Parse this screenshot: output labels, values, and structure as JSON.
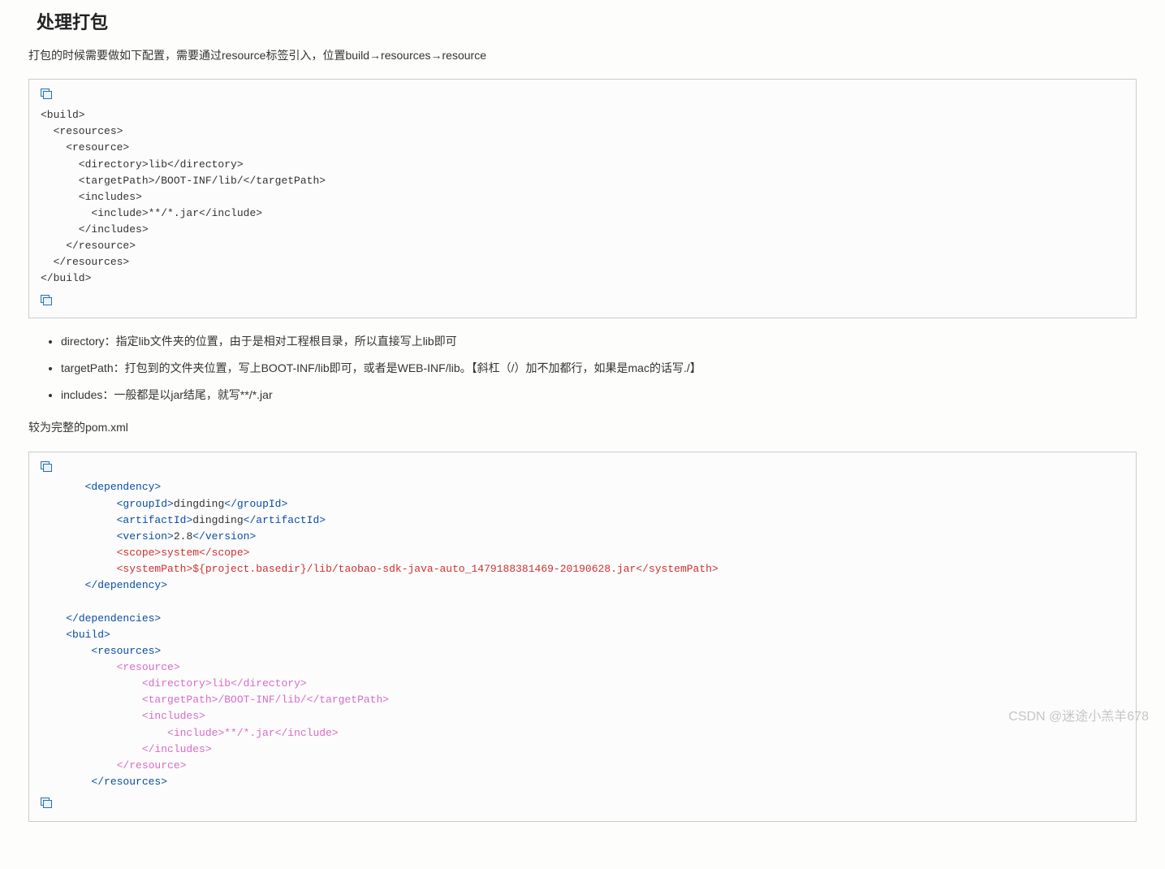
{
  "heading": "处理打包",
  "intro": "打包的时候需要做如下配置，需要通过resource标签引入，位置build→resources→resource",
  "code1": "<build>\n  <resources>\n    <resource>\n      <directory>lib</directory>\n      <targetPath>/BOOT-INF/lib/</targetPath>\n      <includes>\n        <include>**/*.jar</include>\n      </includes>\n    </resource>\n  </resources>\n</build>",
  "bullets": [
    "directory：指定lib文件夹的位置，由于是相对工程根目录，所以直接写上lib即可",
    "targetPath：打包到的文件夹位置，写上BOOT-INF/lib即可，或者是WEB-INF/lib。【斜杠（/）加不加都行，如果是mac的话写./】",
    "includes：一般都是以jar结尾，就写**/*.jar"
  ],
  "pomline": "较为完整的pom.xml",
  "code2": {
    "dep_open": "<dependency>",
    "group": {
      "o": "<groupId>",
      "t": "dingding",
      "c": "</groupId>"
    },
    "artifact": {
      "o": "<artifactId>",
      "t": "dingding",
      "c": "</artifactId>"
    },
    "version": {
      "o": "<version>",
      "t": "2.8",
      "c": "</version>"
    },
    "scope": {
      "o": "<scope>",
      "t": "system",
      "c": "</scope>"
    },
    "syspath": {
      "o": "<systemPath>",
      "t": "${project.basedir}/lib/taobao-sdk-java-auto_1479188381469-20190628.jar",
      "c": "</systemPath>"
    },
    "dep_close": "</dependency>",
    "deps_close": "</dependencies>",
    "build_open": "<build>",
    "resources_open": "<resources>",
    "resource_open": "<resource>",
    "dir": {
      "o": "<directory>",
      "t": "lib",
      "c": "</directory>"
    },
    "tpath": {
      "o": "<targetPath>",
      "t": "/BOOT-INF/lib/",
      "c": "</targetPath>"
    },
    "includes_open": "<includes>",
    "include": {
      "o": "<include>",
      "t": "**/*.jar",
      "c": "</include>"
    },
    "includes_close": "</includes>",
    "resource_close": "</resource>",
    "resources_close": "</resources>"
  },
  "watermark": "CSDN @迷途小羔羊678"
}
